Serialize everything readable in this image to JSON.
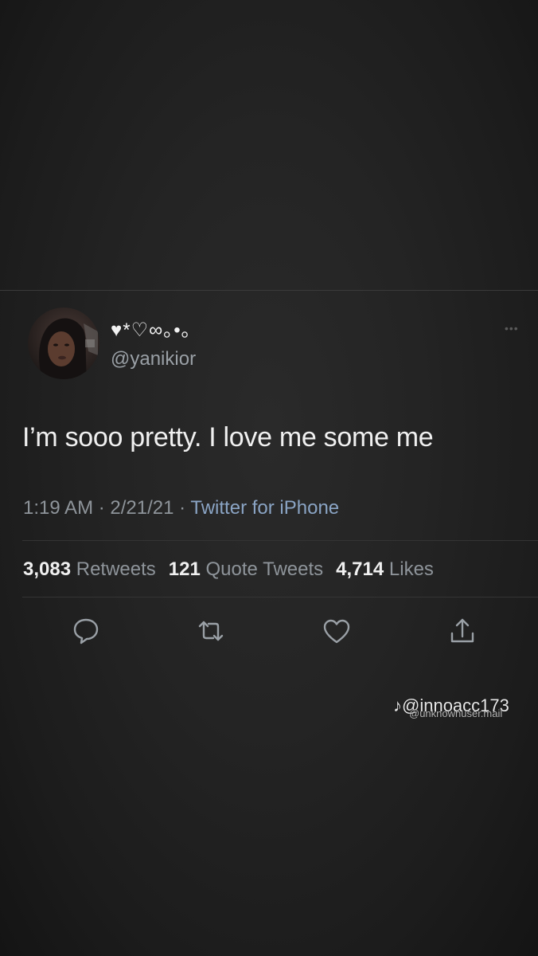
{
  "tweet": {
    "display_name": "♥*♡∞｡•｡",
    "handle": "@yanikior",
    "text": "I’m sooo pretty. I love me some me",
    "time": "1:19 AM",
    "date": "2/21/21",
    "separator": "·",
    "source": "Twitter for iPhone",
    "stats": {
      "retweets_count": "3,083",
      "retweets_label": "Retweets",
      "quotes_count": "121",
      "quotes_label": "Quote Tweets",
      "likes_count": "4,714",
      "likes_label": "Likes"
    },
    "actions": [
      "reply-icon",
      "retweet-icon",
      "like-icon",
      "share-icon"
    ],
    "more_icon": "more-options-icon"
  },
  "watermark": {
    "main": "@innoacc173",
    "overlay": "@unknownuser.mail"
  },
  "colors": {
    "background": "#202020",
    "text_primary": "#f0f0f0",
    "text_secondary": "#8e949a",
    "source_link": "#8aa4c4"
  }
}
